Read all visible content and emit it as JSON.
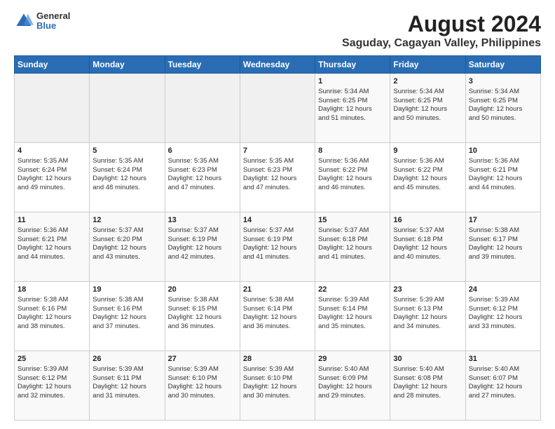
{
  "header": {
    "logo": {
      "line1": "General",
      "line2": "Blue"
    },
    "title": "August 2024",
    "subtitle": "Saguday, Cagayan Valley, Philippines"
  },
  "calendar": {
    "days": [
      "Sunday",
      "Monday",
      "Tuesday",
      "Wednesday",
      "Thursday",
      "Friday",
      "Saturday"
    ],
    "weeks": [
      [
        {
          "day": "",
          "content": ""
        },
        {
          "day": "",
          "content": ""
        },
        {
          "day": "",
          "content": ""
        },
        {
          "day": "",
          "content": ""
        },
        {
          "day": "1",
          "content": "Sunrise: 5:34 AM\nSunset: 6:25 PM\nDaylight: 12 hours\nand 51 minutes."
        },
        {
          "day": "2",
          "content": "Sunrise: 5:34 AM\nSunset: 6:25 PM\nDaylight: 12 hours\nand 50 minutes."
        },
        {
          "day": "3",
          "content": "Sunrise: 5:34 AM\nSunset: 6:25 PM\nDaylight: 12 hours\nand 50 minutes."
        }
      ],
      [
        {
          "day": "4",
          "content": "Sunrise: 5:35 AM\nSunset: 6:24 PM\nDaylight: 12 hours\nand 49 minutes."
        },
        {
          "day": "5",
          "content": "Sunrise: 5:35 AM\nSunset: 6:24 PM\nDaylight: 12 hours\nand 48 minutes."
        },
        {
          "day": "6",
          "content": "Sunrise: 5:35 AM\nSunset: 6:23 PM\nDaylight: 12 hours\nand 47 minutes."
        },
        {
          "day": "7",
          "content": "Sunrise: 5:35 AM\nSunset: 6:23 PM\nDaylight: 12 hours\nand 47 minutes."
        },
        {
          "day": "8",
          "content": "Sunrise: 5:36 AM\nSunset: 6:22 PM\nDaylight: 12 hours\nand 46 minutes."
        },
        {
          "day": "9",
          "content": "Sunrise: 5:36 AM\nSunset: 6:22 PM\nDaylight: 12 hours\nand 45 minutes."
        },
        {
          "day": "10",
          "content": "Sunrise: 5:36 AM\nSunset: 6:21 PM\nDaylight: 12 hours\nand 44 minutes."
        }
      ],
      [
        {
          "day": "11",
          "content": "Sunrise: 5:36 AM\nSunset: 6:21 PM\nDaylight: 12 hours\nand 44 minutes."
        },
        {
          "day": "12",
          "content": "Sunrise: 5:37 AM\nSunset: 6:20 PM\nDaylight: 12 hours\nand 43 minutes."
        },
        {
          "day": "13",
          "content": "Sunrise: 5:37 AM\nSunset: 6:19 PM\nDaylight: 12 hours\nand 42 minutes."
        },
        {
          "day": "14",
          "content": "Sunrise: 5:37 AM\nSunset: 6:19 PM\nDaylight: 12 hours\nand 41 minutes."
        },
        {
          "day": "15",
          "content": "Sunrise: 5:37 AM\nSunset: 6:18 PM\nDaylight: 12 hours\nand 41 minutes."
        },
        {
          "day": "16",
          "content": "Sunrise: 5:37 AM\nSunset: 6:18 PM\nDaylight: 12 hours\nand 40 minutes."
        },
        {
          "day": "17",
          "content": "Sunrise: 5:38 AM\nSunset: 6:17 PM\nDaylight: 12 hours\nand 39 minutes."
        }
      ],
      [
        {
          "day": "18",
          "content": "Sunrise: 5:38 AM\nSunset: 6:16 PM\nDaylight: 12 hours\nand 38 minutes."
        },
        {
          "day": "19",
          "content": "Sunrise: 5:38 AM\nSunset: 6:16 PM\nDaylight: 12 hours\nand 37 minutes."
        },
        {
          "day": "20",
          "content": "Sunrise: 5:38 AM\nSunset: 6:15 PM\nDaylight: 12 hours\nand 36 minutes."
        },
        {
          "day": "21",
          "content": "Sunrise: 5:38 AM\nSunset: 6:14 PM\nDaylight: 12 hours\nand 36 minutes."
        },
        {
          "day": "22",
          "content": "Sunrise: 5:39 AM\nSunset: 6:14 PM\nDaylight: 12 hours\nand 35 minutes."
        },
        {
          "day": "23",
          "content": "Sunrise: 5:39 AM\nSunset: 6:13 PM\nDaylight: 12 hours\nand 34 minutes."
        },
        {
          "day": "24",
          "content": "Sunrise: 5:39 AM\nSunset: 6:12 PM\nDaylight: 12 hours\nand 33 minutes."
        }
      ],
      [
        {
          "day": "25",
          "content": "Sunrise: 5:39 AM\nSunset: 6:12 PM\nDaylight: 12 hours\nand 32 minutes."
        },
        {
          "day": "26",
          "content": "Sunrise: 5:39 AM\nSunset: 6:11 PM\nDaylight: 12 hours\nand 31 minutes."
        },
        {
          "day": "27",
          "content": "Sunrise: 5:39 AM\nSunset: 6:10 PM\nDaylight: 12 hours\nand 30 minutes."
        },
        {
          "day": "28",
          "content": "Sunrise: 5:39 AM\nSunset: 6:10 PM\nDaylight: 12 hours\nand 30 minutes."
        },
        {
          "day": "29",
          "content": "Sunrise: 5:40 AM\nSunset: 6:09 PM\nDaylight: 12 hours\nand 29 minutes."
        },
        {
          "day": "30",
          "content": "Sunrise: 5:40 AM\nSunset: 6:08 PM\nDaylight: 12 hours\nand 28 minutes."
        },
        {
          "day": "31",
          "content": "Sunrise: 5:40 AM\nSunset: 6:07 PM\nDaylight: 12 hours\nand 27 minutes."
        }
      ]
    ]
  }
}
